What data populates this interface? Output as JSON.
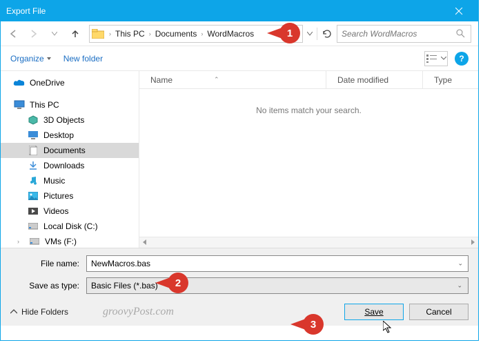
{
  "title": "Export File",
  "breadcrumb": {
    "root": "This PC",
    "p1": "Documents",
    "p2": "WordMacros"
  },
  "search": {
    "placeholder": "Search WordMacros"
  },
  "toolbar": {
    "organize": "Organize",
    "newfolder": "New folder",
    "help": "?"
  },
  "tree": {
    "onedrive": "OneDrive",
    "thispc": "This PC",
    "items": [
      {
        "label": "3D Objects"
      },
      {
        "label": "Desktop"
      },
      {
        "label": "Documents"
      },
      {
        "label": "Downloads"
      },
      {
        "label": "Music"
      },
      {
        "label": "Pictures"
      },
      {
        "label": "Videos"
      },
      {
        "label": "Local Disk (C:)"
      },
      {
        "label": "VMs (F:)"
      }
    ]
  },
  "columns": {
    "name": "Name",
    "date": "Date modified",
    "type": "Type"
  },
  "empty_msg": "No items match your search.",
  "filename_label": "File name:",
  "filename_value": "NewMacros.bas",
  "saveas_label": "Save as type:",
  "saveas_value": "Basic Files (*.bas)",
  "hide_folders": "Hide Folders",
  "save_label": "Save",
  "cancel_label": "Cancel",
  "watermark": "groovyPost.com",
  "callouts": {
    "c1": "1",
    "c2": "2",
    "c3": "3"
  }
}
